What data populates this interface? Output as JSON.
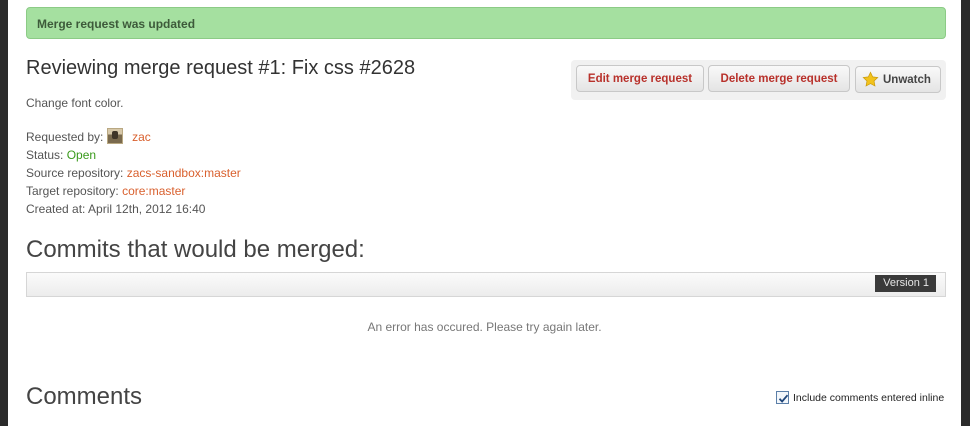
{
  "flash": {
    "message": "Merge request was updated"
  },
  "header": {
    "title": "Reviewing merge request #1: Fix css #2628"
  },
  "actions": {
    "edit_label": "Edit merge request",
    "delete_label": "Delete merge request",
    "watch_label": "Unwatch",
    "watch_icon": "star-icon"
  },
  "description": "Change font color.",
  "meta": {
    "requested_by_label": "Requested by:",
    "requested_by_user": "zac",
    "status_label": "Status:",
    "status_value": "Open",
    "source_label": "Source repository:",
    "source_value": "zacs-sandbox:master",
    "target_label": "Target repository:",
    "target_value": "core:master",
    "created_label": "Created at:",
    "created_value": "April 12th, 2012 16:40"
  },
  "commits": {
    "title": "Commits that would be merged:",
    "version_label": "Version 1",
    "error_message": "An error has occured. Please try again later."
  },
  "comments": {
    "title": "Comments",
    "include_inline_label": "Include comments entered inline",
    "include_inline_checked": true
  },
  "colors": {
    "flash_bg": "#a5e0a0",
    "link": "#d9602e",
    "status_open": "#3a9a1c",
    "action_text": "#b8312b"
  }
}
